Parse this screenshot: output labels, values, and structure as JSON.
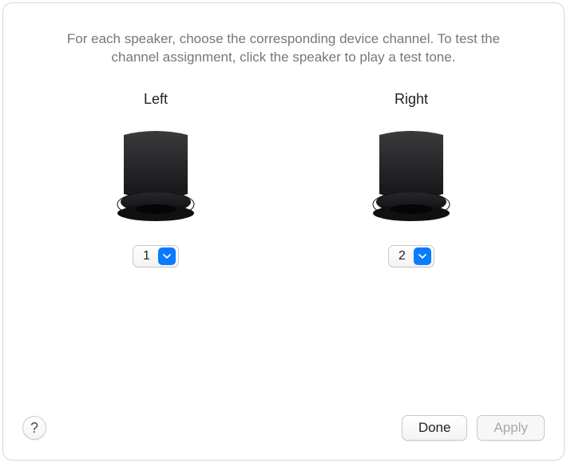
{
  "instructions": "For each speaker, choose the corresponding device channel. To test the channel assignment, click the speaker to play a test tone.",
  "speakers": {
    "left": {
      "label": "Left",
      "channel": "1"
    },
    "right": {
      "label": "Right",
      "channel": "2"
    }
  },
  "footer": {
    "help": "?",
    "done": "Done",
    "apply": "Apply"
  }
}
